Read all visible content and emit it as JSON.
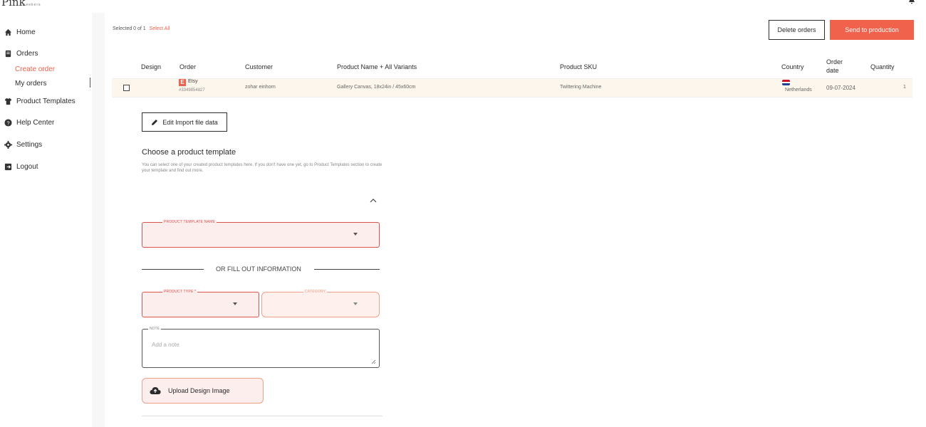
{
  "brand": {
    "logo_text": "Pink",
    "logo_sub": "seekers"
  },
  "sidebar": {
    "home": "Home",
    "orders": "Orders",
    "create_order": "Create order",
    "my_orders": "My orders",
    "product_templates": "Product Templates",
    "help_center": "Help Center",
    "settings": "Settings",
    "logout": "Logout"
  },
  "toolbar": {
    "selected_text": "Selected 0 of 1",
    "select_all": "Select All",
    "delete_orders": "Delete orders",
    "send_to_production": "Send to production"
  },
  "table": {
    "headers": {
      "design": "Design",
      "order": "Order",
      "customer": "Customer",
      "product_name": "Product Name + All Variants",
      "product_sku": "Product SKU",
      "country": "Country",
      "order_date_1": "Order",
      "order_date_2": "date",
      "quantity": "Quantity"
    },
    "rows": [
      {
        "order_source": "Etsy",
        "order_number": "#3349854827",
        "customer": "zohar einhorn",
        "product_name": "Gallery Canvas, 18x24in / 45x60cm",
        "product_sku": "Twittering Machine",
        "country": "Netherlands",
        "order_date": "09-07-2024",
        "quantity": "1"
      }
    ]
  },
  "form": {
    "edit_import": "Edit Import file data",
    "choose_title": "Choose a product template",
    "choose_desc": "You can select one of your created product templates here. If you don't have one yet, go to Product Templates section to create your template and find out more.",
    "template_name_label": "PRODUCT TEMPLATE NAME",
    "or_fill": "OR FILL OUT INFORMATION",
    "product_type_label": "PRODUCT TYPE *",
    "category_label": "CATEGORY",
    "note_label": "NOTE",
    "note_placeholder": "Add a note",
    "upload_label": "Upload Design Image"
  },
  "colors": {
    "accent": "#f0624c",
    "row_highlight": "#fdf6ec",
    "field_bg": "#fdeeee"
  }
}
